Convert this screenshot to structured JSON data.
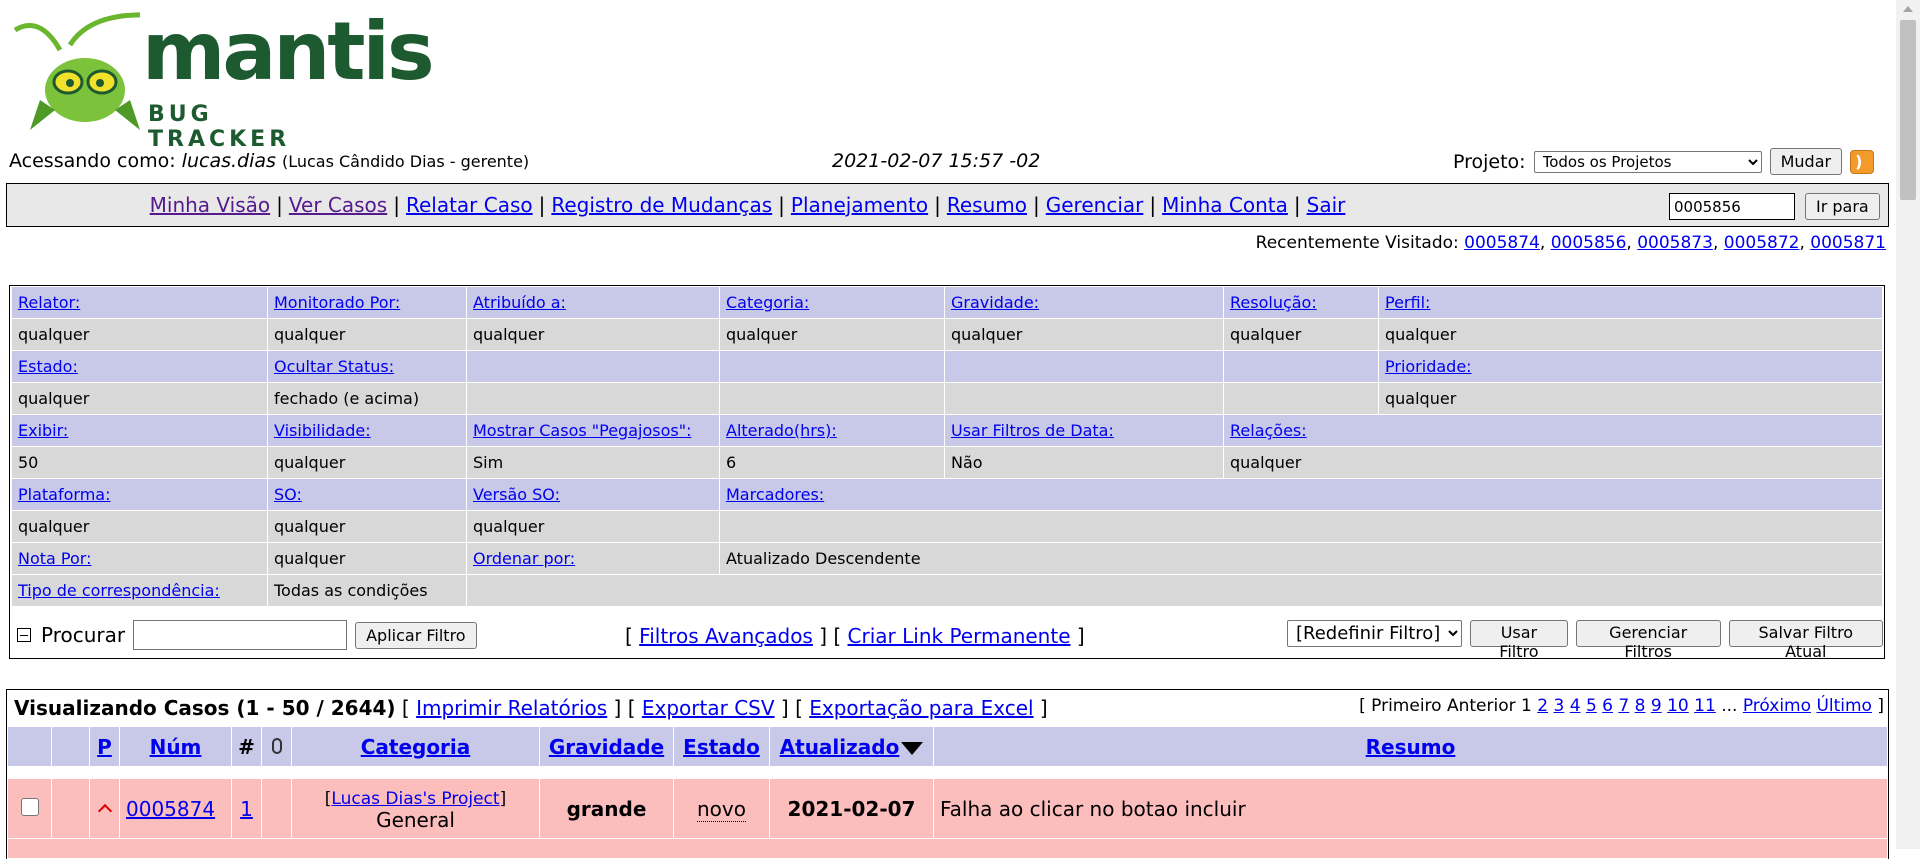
{
  "logo": {
    "word": "mantis",
    "sub": "BUG TRACKER"
  },
  "login": {
    "label": "Acessando como:",
    "user": "lucas.dias",
    "realname": "(Lucas Cândido Dias - gerente)",
    "datetime": "2021-02-07 15:57 -02",
    "project_label": "Projeto:",
    "project_selected": "Todos os Projetos",
    "change_button": "Mudar"
  },
  "menu": {
    "items": [
      "Minha Visão",
      "Ver Casos",
      "Relatar Caso",
      "Registro de Mudanças",
      "Planejamento",
      "Resumo",
      "Gerenciar",
      "Minha Conta",
      "Sair"
    ],
    "jump_value": "0005856",
    "jump_button": "Ir para"
  },
  "recent": {
    "label": "Recentemente Visitado:",
    "items": [
      "0005874",
      "0005856",
      "0005873",
      "0005872",
      "0005871"
    ]
  },
  "filter": {
    "relator": "Relator:",
    "relator_v": "qualquer",
    "monitorado": "Monitorado Por:",
    "monitorado_v": "qualquer",
    "atribuido": "Atribuído a:",
    "atribuido_v": "qualquer",
    "categoria": "Categoria:",
    "categoria_v": "qualquer",
    "gravidade": "Gravidade:",
    "gravidade_v": "qualquer",
    "resolucao": "Resolução:",
    "resolucao_v": "qualquer",
    "perfil": "Perfil:",
    "perfil_v": "qualquer",
    "estado": "Estado:",
    "estado_v": "qualquer",
    "ocultar": "Ocultar Status:",
    "ocultar_v": "fechado (e acima)",
    "prioridade": "Prioridade:",
    "prioridade_v": "qualquer",
    "exibir": "Exibir:",
    "exibir_v": "50",
    "visibilidade": "Visibilidade:",
    "visibilidade_v": "qualquer",
    "pegajosos": "Mostrar Casos \"Pegajosos\":",
    "pegajosos_v": "Sim",
    "alterado": "Alterado(hrs):",
    "alterado_v": "6",
    "filtros_data": "Usar Filtros de Data:",
    "filtros_data_v": "Não",
    "relacoes": "Relações:",
    "relacoes_v": "qualquer",
    "plataforma": "Plataforma:",
    "plataforma_v": "qualquer",
    "so": "SO:",
    "so_v": "qualquer",
    "versao_so": "Versão SO:",
    "versao_so_v": "qualquer",
    "marcadores": "Marcadores:",
    "nota_por": "Nota Por:",
    "nota_por_v": "qualquer",
    "ordenar": "Ordenar por:",
    "ordenar_v": "Atualizado Descendente",
    "correspondencia": "Tipo de correspondência:",
    "correspondencia_v": "Todas as condições"
  },
  "search": {
    "label": "Procurar",
    "apply_button": "Aplicar Filtro",
    "advanced": "Filtros Avançados",
    "permalink": "Criar Link Permanente",
    "reset_selected": "[Redefinir Filtro]",
    "use_button": "Usar Filtro",
    "manage_button": "Gerenciar Filtros",
    "save_button": "Salvar Filtro Atual"
  },
  "results": {
    "title": "Visualizando Casos (1 - 50 / 2644)",
    "print": "Imprimir Relatórios",
    "csv": "Exportar CSV",
    "excel": "Exportação para Excel",
    "pager_prefix": "[ Primeiro Anterior 1",
    "pages": [
      "2",
      "3",
      "4",
      "5",
      "6",
      "7",
      "8",
      "9",
      "10",
      "11"
    ],
    "ellipsis": "...",
    "next": "Próximo",
    "last": "Último",
    "pager_suffix": "]"
  },
  "columns": {
    "p": "P",
    "num": "Núm",
    "hash": "#",
    "categoria": "Categoria",
    "gravidade": "Gravidade",
    "estado": "Estado",
    "atualizado": "Atualizado",
    "resumo": "Resumo"
  },
  "rows": [
    {
      "num": "0005874",
      "notes": "1",
      "project": "Lucas Dias's Project",
      "category": "General",
      "severity": "grande",
      "status": "novo",
      "updated": "2021-02-07",
      "summary": "Falha ao clicar no botao incluir"
    }
  ],
  "colors": {
    "header_bg": "#c8c8e8",
    "value_bg": "#d8d8d8",
    "row_new": "#fcbdbd",
    "link": "#0000ee"
  }
}
